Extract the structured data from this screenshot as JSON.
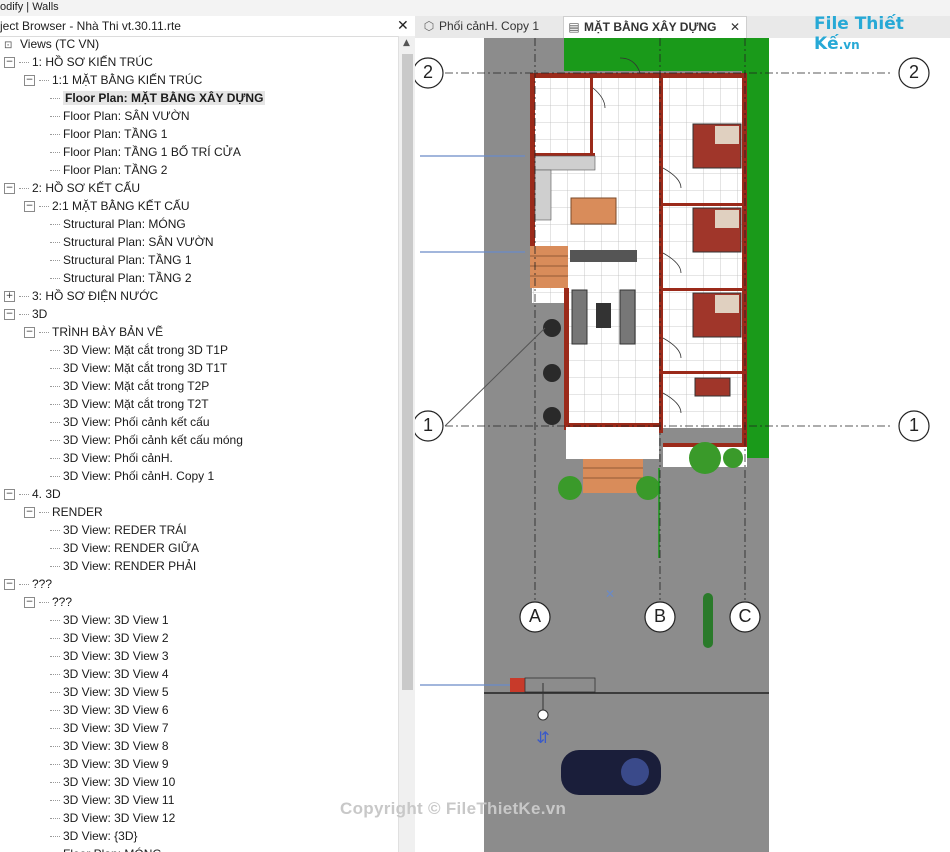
{
  "ribbon": {
    "context": "odify | Walls"
  },
  "project_browser": {
    "title": "ject Browser - Nhà Thi vt.30.11.rte",
    "rows": [
      {
        "level": 0,
        "toggle": "",
        "label": "Views (TC VN)"
      },
      {
        "level": 0,
        "toggle": "−",
        "label": "1: HỒ SƠ KIẾN TRÚC"
      },
      {
        "level": 1,
        "toggle": "−",
        "label": "1:1 MẶT BẰNG KIẾN TRÚC"
      },
      {
        "level": 2,
        "toggle": "",
        "label": "Floor Plan: MẶT BẰNG XÂY DỰNG",
        "active": true
      },
      {
        "level": 2,
        "toggle": "",
        "label": "Floor Plan: SÂN VƯỜN"
      },
      {
        "level": 2,
        "toggle": "",
        "label": "Floor Plan: TẦNG 1"
      },
      {
        "level": 2,
        "toggle": "",
        "label": "Floor Plan: TẦNG 1 BỐ TRÍ CỬA"
      },
      {
        "level": 2,
        "toggle": "",
        "label": "Floor Plan: TẦNG 2"
      },
      {
        "level": 0,
        "toggle": "−",
        "label": "2: HỒ SƠ KẾT CẤU"
      },
      {
        "level": 1,
        "toggle": "−",
        "label": "2:1 MẶT BẰNG KẾT CẤU"
      },
      {
        "level": 2,
        "toggle": "",
        "label": "Structural Plan: MÓNG"
      },
      {
        "level": 2,
        "toggle": "",
        "label": "Structural Plan: SÂN VƯỜN"
      },
      {
        "level": 2,
        "toggle": "",
        "label": "Structural Plan: TẦNG 1"
      },
      {
        "level": 2,
        "toggle": "",
        "label": "Structural Plan: TẦNG 2"
      },
      {
        "level": 0,
        "toggle": "+",
        "label": "3: HỒ SƠ ĐIỆN NƯỚC"
      },
      {
        "level": 0,
        "toggle": "−",
        "label": "3D"
      },
      {
        "level": 1,
        "toggle": "−",
        "label": "TRÌNH BÀY BẢN VẼ"
      },
      {
        "level": 2,
        "toggle": "",
        "label": "3D View: Mặt cắt trong 3D T1P"
      },
      {
        "level": 2,
        "toggle": "",
        "label": "3D View: Mặt cắt trong 3D T1T"
      },
      {
        "level": 2,
        "toggle": "",
        "label": "3D View: Mặt cắt trong T2P"
      },
      {
        "level": 2,
        "toggle": "",
        "label": "3D View: Mặt cắt trong T2T"
      },
      {
        "level": 2,
        "toggle": "",
        "label": "3D View: Phối cảnh kết cấu"
      },
      {
        "level": 2,
        "toggle": "",
        "label": "3D View: Phối cảnh kết cấu móng"
      },
      {
        "level": 2,
        "toggle": "",
        "label": "3D View: Phối cảnH."
      },
      {
        "level": 2,
        "toggle": "",
        "label": "3D View: Phối cảnH. Copy 1"
      },
      {
        "level": 0,
        "toggle": "−",
        "label": "4. 3D"
      },
      {
        "level": 1,
        "toggle": "−",
        "label": "RENDER"
      },
      {
        "level": 2,
        "toggle": "",
        "label": "3D View: REDER TRÁI"
      },
      {
        "level": 2,
        "toggle": "",
        "label": "3D View: RENDER GIỮA"
      },
      {
        "level": 2,
        "toggle": "",
        "label": "3D View: RENDER PHẢI"
      },
      {
        "level": 0,
        "toggle": "−",
        "label": "???"
      },
      {
        "level": 1,
        "toggle": "−",
        "label": "???"
      },
      {
        "level": 2,
        "toggle": "",
        "label": "3D View: 3D View 1"
      },
      {
        "level": 2,
        "toggle": "",
        "label": "3D View: 3D View 2"
      },
      {
        "level": 2,
        "toggle": "",
        "label": "3D View: 3D View 3"
      },
      {
        "level": 2,
        "toggle": "",
        "label": "3D View: 3D View 4"
      },
      {
        "level": 2,
        "toggle": "",
        "label": "3D View: 3D View 5"
      },
      {
        "level": 2,
        "toggle": "",
        "label": "3D View: 3D View 6"
      },
      {
        "level": 2,
        "toggle": "",
        "label": "3D View: 3D View 7"
      },
      {
        "level": 2,
        "toggle": "",
        "label": "3D View: 3D View 8"
      },
      {
        "level": 2,
        "toggle": "",
        "label": "3D View: 3D View 9"
      },
      {
        "level": 2,
        "toggle": "",
        "label": "3D View: 3D View 10"
      },
      {
        "level": 2,
        "toggle": "",
        "label": "3D View: 3D View 11"
      },
      {
        "level": 2,
        "toggle": "",
        "label": "3D View: 3D View 12"
      },
      {
        "level": 2,
        "toggle": "",
        "label": "3D View: {3D}"
      },
      {
        "level": 2,
        "toggle": "",
        "label": "Floor Plan: MÓNG"
      }
    ]
  },
  "tabs": [
    {
      "label": "Phối cảnH. Copy 1",
      "active": false,
      "icon": "3d-view-icon"
    },
    {
      "label": "MẶT BẰNG XÂY DỰNG",
      "active": true,
      "icon": "floor-plan-icon"
    }
  ],
  "grid_labels": {
    "row_top": "2",
    "row_top_right": "2",
    "row_bottom": "1",
    "row_bottom_right": "1",
    "col_a": "A",
    "col_b": "B",
    "col_c": "C"
  },
  "logo": {
    "main": "File Thiết Kế",
    "suffix": ".vn"
  },
  "watermark": "Copyright © FileThietKe.vn",
  "colors": {
    "wall": "#9b2a1a",
    "road": "#8c8c8c",
    "grass": "#1a9a1a",
    "tile_grid": "#bcbcbc",
    "bed": "#a0362a",
    "wood": "#d98c5a",
    "grid_line": "#222222",
    "logo": "#27a9d6"
  }
}
